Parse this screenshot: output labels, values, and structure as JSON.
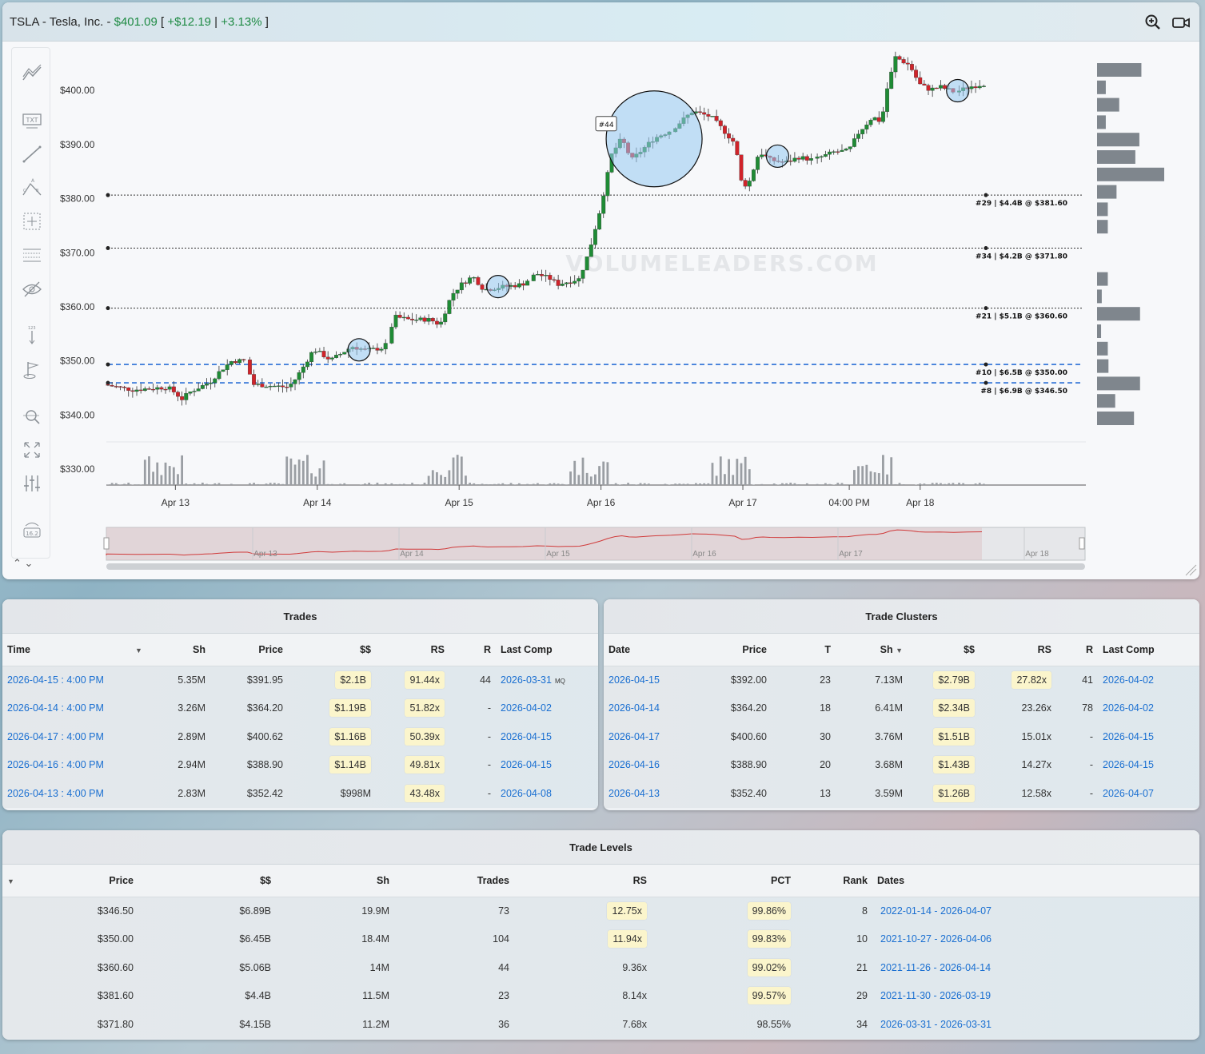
{
  "header": {
    "symbol_name": "TSLA - Tesla, Inc. - ",
    "price": "$401.09",
    "bracket_open": " [ ",
    "change": "+$12.19",
    "sep": " | ",
    "change_pct": "+3.13%",
    "bracket_close": " ]"
  },
  "icons": {
    "zoom": "zoom-in-icon",
    "video": "video-camera-icon",
    "tools": [
      "trend-lines-icon",
      "text-icon",
      "line-icon",
      "abc-pattern-icon",
      "crosshair-box-icon",
      "fibonacci-icon",
      "hide-eye-icon",
      "measure-icon",
      "flag-icon",
      "zoom-magnifier-icon",
      "fullscreen-icon",
      "adjust-icon",
      "counter-icon"
    ]
  },
  "chart_data": {
    "type": "candlestick",
    "watermark": "VOLUMELEADERS.COM",
    "y_ticks": [
      "$400.00",
      "$390.00",
      "$380.00",
      "$370.00",
      "$360.00",
      "$350.00",
      "$340.00",
      "$330.00"
    ],
    "y_tick_values": [
      400,
      390,
      380,
      370,
      360,
      350,
      340,
      330
    ],
    "ylim": [
      327,
      408
    ],
    "x_ticks": [
      "Apr 13",
      "Apr 14",
      "Apr 15",
      "Apr 16",
      "Apr 17",
      "04:00 PM",
      "Apr 18"
    ],
    "x_tick_positions": [
      0.25,
      1.25,
      2.25,
      3.25,
      4.25,
      5.0,
      5.5
    ],
    "navigator_ticks": [
      "Apr 13",
      "Apr 14",
      "Apr 15",
      "Apr 16",
      "Apr 17",
      "Apr 18"
    ],
    "levels": [
      {
        "label": "#29 | $4.4B @ $381.60",
        "price": 380.5,
        "style": "dotted"
      },
      {
        "label": "#34 | $4.2B @ $371.80",
        "price": 370.7,
        "style": "dotted"
      },
      {
        "label": "#21 | $5.1B @ $360.60",
        "price": 359.6,
        "style": "dotted"
      },
      {
        "label": "#10 | $6.5B @ $350.00",
        "price": 349.2,
        "style": "dashed"
      },
      {
        "label": "#8 | $6.9B @ $346.50",
        "price": 345.8,
        "style": "dashed"
      }
    ],
    "bubbles": [
      {
        "x": 1.77,
        "price": 351.9,
        "size": "small"
      },
      {
        "x": 2.75,
        "price": 363.6,
        "size": "small"
      },
      {
        "x": 3.85,
        "price": 390.9,
        "size": "large",
        "label": "#44"
      },
      {
        "x": 4.72,
        "price": 387.7,
        "size": "small"
      },
      {
        "x": 5.99,
        "price": 399.8,
        "size": "small"
      }
    ],
    "volume_profile": [
      0.66,
      0.13,
      0.33,
      0.13,
      0.63,
      0.57,
      1.0,
      0.29,
      0.16,
      0.16,
      0,
      0,
      0.16,
      0.07,
      0.64,
      0.06,
      0.16,
      0.17,
      0.64,
      0.27,
      0.55
    ]
  },
  "trades": {
    "title": "Trades",
    "columns": [
      "Time",
      "Sh",
      "Price",
      "$$",
      "RS",
      "R",
      "Last Comp"
    ],
    "rows": [
      {
        "time": "2026-04-15 : 4:00 PM",
        "sh": "5.35M",
        "price": "$391.95",
        "dollars": "$2.1B",
        "rs": "91.44x",
        "r": "44",
        "last": "2026-03-31",
        "mq": "MQ",
        "hl_d": true,
        "hl_rs": true
      },
      {
        "time": "2026-04-14 : 4:00 PM",
        "sh": "3.26M",
        "price": "$364.20",
        "dollars": "$1.19B",
        "rs": "51.82x",
        "r": "-",
        "last": "2026-04-02",
        "mq": "",
        "hl_d": true,
        "hl_rs": true
      },
      {
        "time": "2026-04-17 : 4:00 PM",
        "sh": "2.89M",
        "price": "$400.62",
        "dollars": "$1.16B",
        "rs": "50.39x",
        "r": "-",
        "last": "2026-04-15",
        "mq": "",
        "hl_d": true,
        "hl_rs": true
      },
      {
        "time": "2026-04-16 : 4:00 PM",
        "sh": "2.94M",
        "price": "$388.90",
        "dollars": "$1.14B",
        "rs": "49.81x",
        "r": "-",
        "last": "2026-04-15",
        "mq": "",
        "hl_d": true,
        "hl_rs": true
      },
      {
        "time": "2026-04-13 : 4:00 PM",
        "sh": "2.83M",
        "price": "$352.42",
        "dollars": "$998M",
        "rs": "43.48x",
        "r": "-",
        "last": "2026-04-08",
        "mq": "",
        "hl_d": false,
        "hl_rs": true
      }
    ]
  },
  "clusters": {
    "title": "Trade Clusters",
    "columns": [
      "Date",
      "Price",
      "T",
      "Sh",
      "$$",
      "RS",
      "R",
      "Last Comp"
    ],
    "rows": [
      {
        "date": "2026-04-15",
        "price": "$392.00",
        "t": "23",
        "sh": "7.13M",
        "dollars": "$2.79B",
        "rs": "27.82x",
        "r": "41",
        "last": "2026-04-02",
        "hl_rs": true
      },
      {
        "date": "2026-04-14",
        "price": "$364.20",
        "t": "18",
        "sh": "6.41M",
        "dollars": "$2.34B",
        "rs": "23.26x",
        "r": "78",
        "last": "2026-04-02",
        "hl_rs": false
      },
      {
        "date": "2026-04-17",
        "price": "$400.60",
        "t": "30",
        "sh": "3.76M",
        "dollars": "$1.51B",
        "rs": "15.01x",
        "r": "-",
        "last": "2026-04-15",
        "hl_rs": false
      },
      {
        "date": "2026-04-16",
        "price": "$388.90",
        "t": "20",
        "sh": "3.68M",
        "dollars": "$1.43B",
        "rs": "14.27x",
        "r": "-",
        "last": "2026-04-15",
        "hl_rs": false
      },
      {
        "date": "2026-04-13",
        "price": "$352.40",
        "t": "13",
        "sh": "3.59M",
        "dollars": "$1.26B",
        "rs": "12.58x",
        "r": "-",
        "last": "2026-04-07",
        "hl_rs": false
      }
    ]
  },
  "levels": {
    "title": "Trade Levels",
    "columns": [
      "Price",
      "$$",
      "Sh",
      "Trades",
      "RS",
      "PCT",
      "Rank",
      "Dates"
    ],
    "rows": [
      {
        "price": "$346.50",
        "dollars": "$6.89B",
        "sh": "19.9M",
        "trades": "73",
        "rs": "12.75x",
        "pct": "99.86%",
        "rank": "8",
        "dates": "2022-01-14 - 2026-04-07",
        "hl_rs": true,
        "hl_pct": true
      },
      {
        "price": "$350.00",
        "dollars": "$6.45B",
        "sh": "18.4M",
        "trades": "104",
        "rs": "11.94x",
        "pct": "99.83%",
        "rank": "10",
        "dates": "2021-10-27 - 2026-04-06",
        "hl_rs": true,
        "hl_pct": true
      },
      {
        "price": "$360.60",
        "dollars": "$5.06B",
        "sh": "14M",
        "trades": "44",
        "rs": "9.36x",
        "pct": "99.02%",
        "rank": "21",
        "dates": "2021-11-26 - 2026-04-14",
        "hl_rs": false,
        "hl_pct": true
      },
      {
        "price": "$381.60",
        "dollars": "$4.4B",
        "sh": "11.5M",
        "trades": "23",
        "rs": "8.14x",
        "pct": "99.57%",
        "rank": "29",
        "dates": "2021-11-30 - 2026-03-19",
        "hl_rs": false,
        "hl_pct": true
      },
      {
        "price": "$371.80",
        "dollars": "$4.15B",
        "sh": "11.2M",
        "trades": "36",
        "rs": "7.68x",
        "pct": "98.55%",
        "rank": "34",
        "dates": "2026-03-31 - 2026-03-31",
        "hl_rs": false,
        "hl_pct": false
      }
    ]
  }
}
